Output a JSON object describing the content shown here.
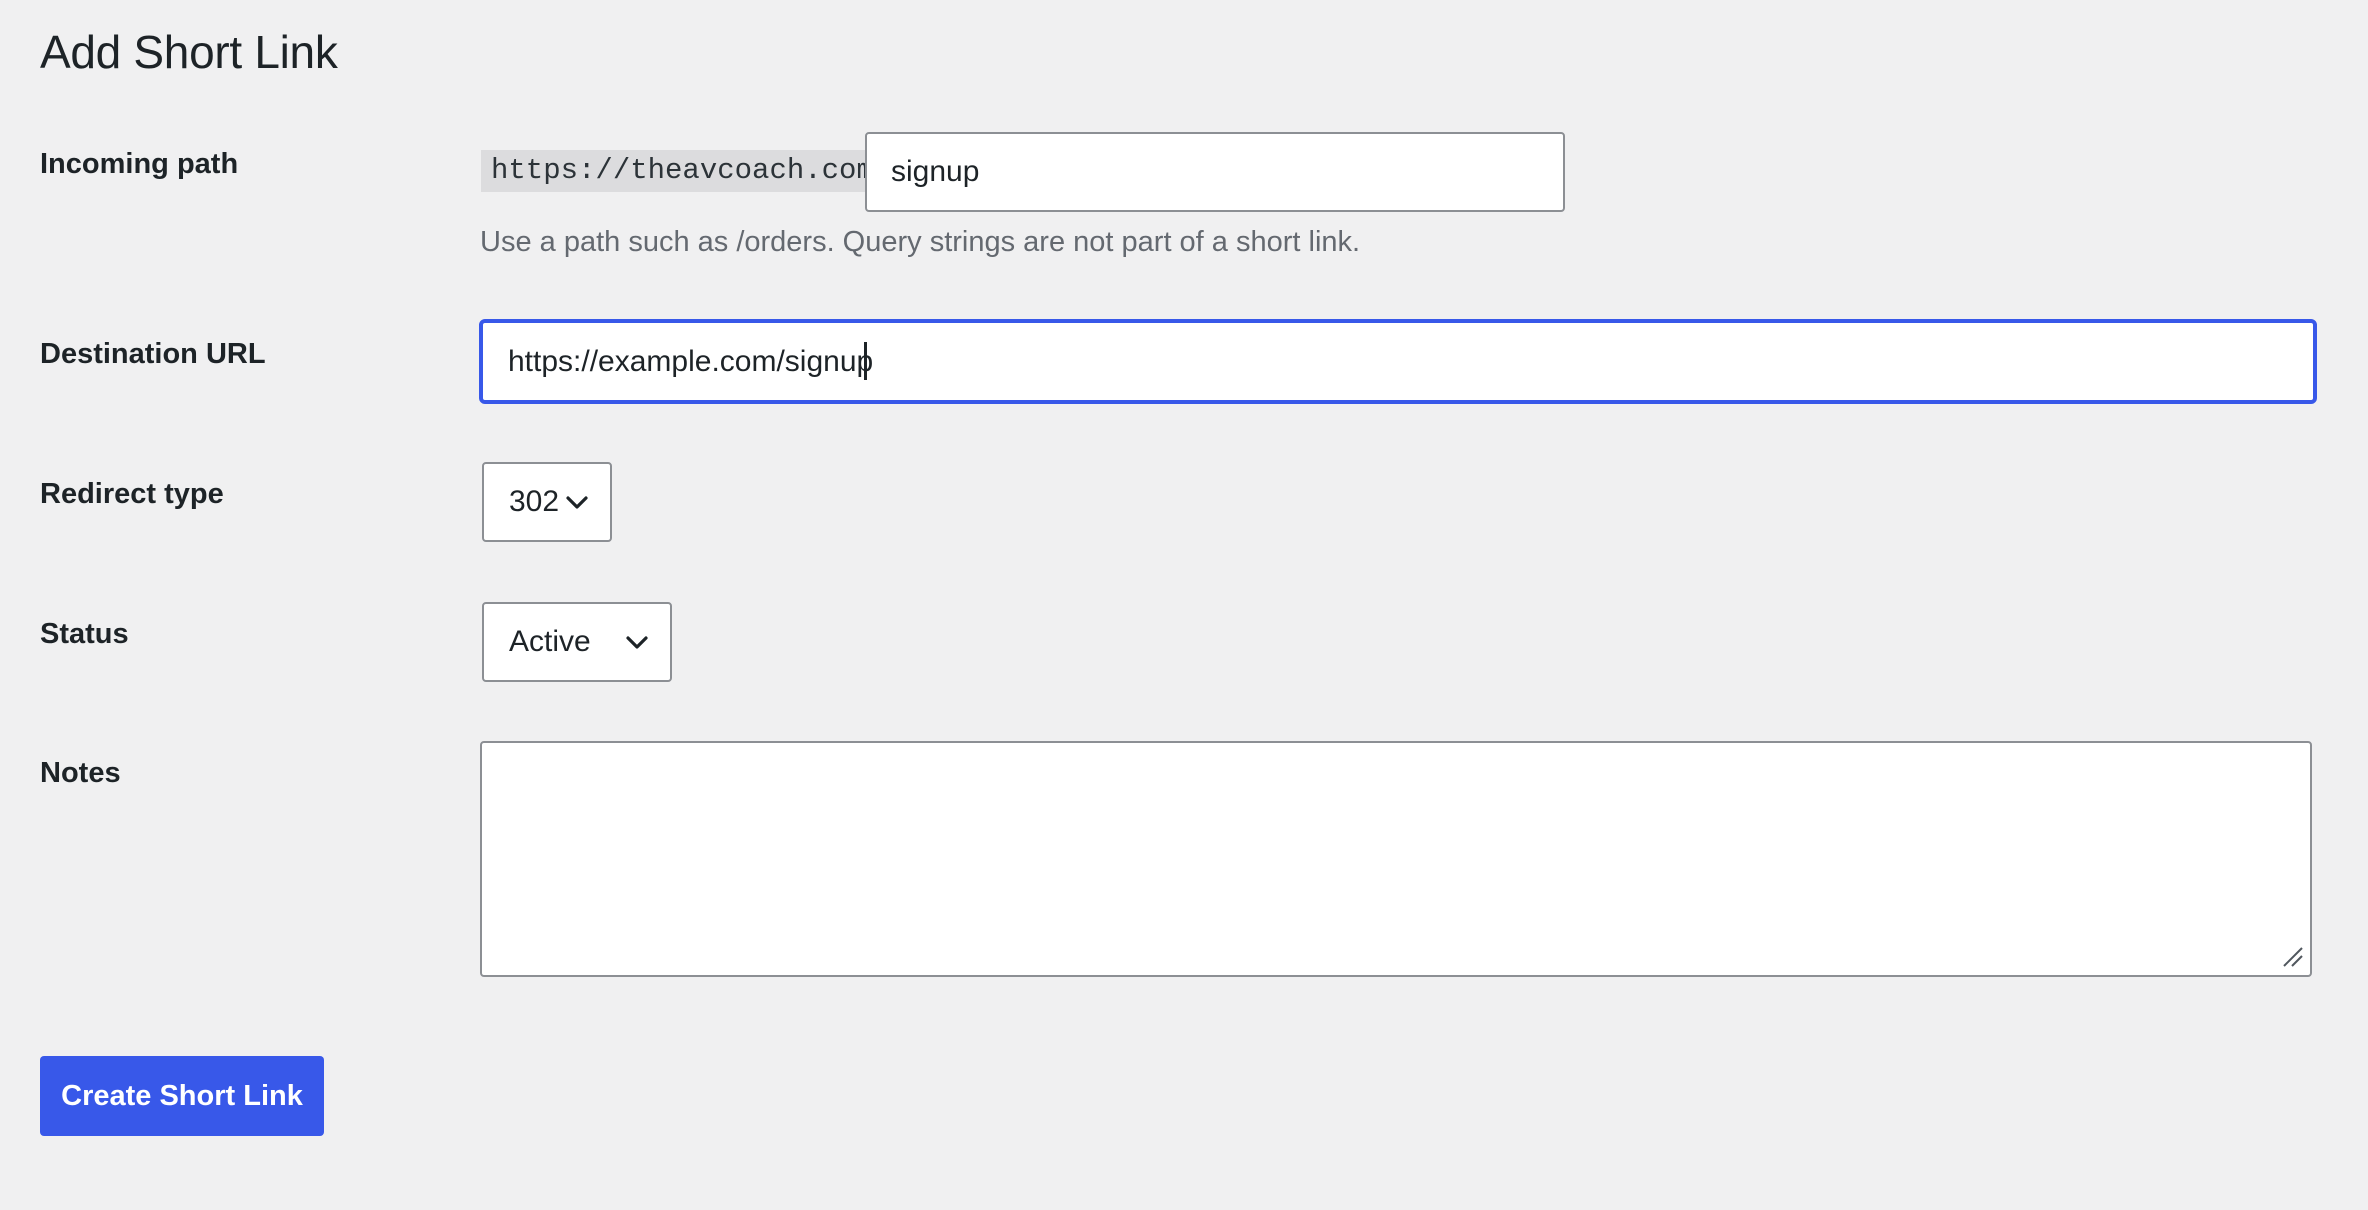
{
  "page": {
    "title": "Add Short Link"
  },
  "form": {
    "incoming_path": {
      "label": "Incoming path",
      "prefix": "https://theavcoach.com/",
      "value": "signup",
      "help": "Use a path such as /orders. Query strings are not part of a short link."
    },
    "destination_url": {
      "label": "Destination URL",
      "value": "https://example.com/signup"
    },
    "redirect_type": {
      "label": "Redirect type",
      "selected": "302"
    },
    "status": {
      "label": "Status",
      "selected": "Active"
    },
    "notes": {
      "label": "Notes",
      "value": ""
    },
    "submit_label": "Create Short Link"
  },
  "icons": {
    "select_chevron": "chevron-down-icon",
    "textarea_resize": "resize-grip-icon"
  },
  "colors": {
    "background": "#f0f0f1",
    "accent": "#3858e9",
    "input_border": "#8c8f94",
    "help_text": "#646970",
    "prefix_bg": "#dcdcde"
  }
}
